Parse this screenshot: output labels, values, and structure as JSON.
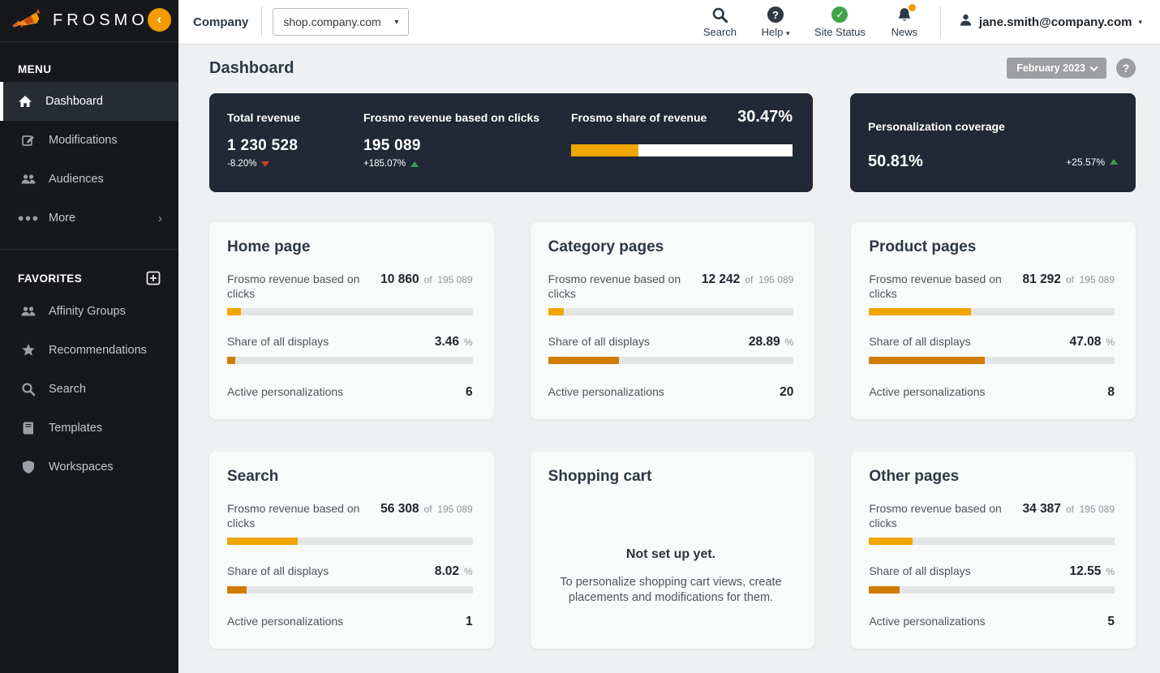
{
  "brand": {
    "name": "FROSMO"
  },
  "topbar": {
    "company_label": "Company",
    "site_selector_value": "shop.company.com",
    "nav": [
      {
        "label": "Search",
        "icon": "search-icon"
      },
      {
        "label": "Help",
        "icon": "question-circle-icon",
        "has_dropdown": true
      },
      {
        "label": "Site Status",
        "icon": "check-circle-icon"
      },
      {
        "label": "News",
        "icon": "bell-icon",
        "has_notification": true
      }
    ],
    "user_email": "jane.smith@company.com"
  },
  "sidebar": {
    "menu_header": "MENU",
    "menu_items": [
      {
        "label": "Dashboard",
        "icon": "home-icon",
        "active": true
      },
      {
        "label": "Modifications",
        "icon": "edit-icon"
      },
      {
        "label": "Audiences",
        "icon": "users-icon"
      },
      {
        "label": "More",
        "icon": "ellipsis-icon",
        "has_submenu": true
      }
    ],
    "favorites_header": "FAVORITES",
    "favorites_items": [
      {
        "label": "Affinity Groups",
        "icon": "users-icon"
      },
      {
        "label": "Recommendations",
        "icon": "star-icon"
      },
      {
        "label": "Search",
        "icon": "search-icon"
      },
      {
        "label": "Templates",
        "icon": "book-icon"
      },
      {
        "label": "Workspaces",
        "icon": "shield-icon"
      }
    ]
  },
  "page": {
    "title": "Dashboard",
    "period_button": "February 2023",
    "help_button": "?"
  },
  "overview": {
    "total_revenue": {
      "label": "Total revenue",
      "value": "1 230 528",
      "change": "-8.20%",
      "direction": "down"
    },
    "frosmo_revenue": {
      "label": "Frosmo revenue based on clicks",
      "value": "195 089",
      "change": "+185.07%",
      "direction": "up"
    },
    "share_of_revenue": {
      "label": "Frosmo share of revenue",
      "value": "30.47%",
      "percent": 30.47
    },
    "personalization_coverage": {
      "label": "Personalization coverage",
      "value": "50.81%",
      "change": "+25.57%",
      "direction": "up"
    }
  },
  "shared": {
    "revenue_label": "Frosmo revenue based on clicks",
    "of_label": "of",
    "revenue_total": "195 089",
    "share_label": "Share of all displays",
    "percent_sign": "%",
    "active_label": "Active personalizations"
  },
  "cards": [
    {
      "title": "Home page",
      "revenue": "10 860",
      "revenue_pct": 5.57,
      "share": "3.46",
      "share_pct": 3.46,
      "active": "6"
    },
    {
      "title": "Category pages",
      "revenue": "12 242",
      "revenue_pct": 6.27,
      "share": "28.89",
      "share_pct": 28.89,
      "active": "20"
    },
    {
      "title": "Product pages",
      "revenue": "81 292",
      "revenue_pct": 41.67,
      "share": "47.08",
      "share_pct": 47.08,
      "active": "8"
    },
    {
      "title": "Search",
      "revenue": "56 308",
      "revenue_pct": 28.86,
      "share": "8.02",
      "share_pct": 8.02,
      "active": "1"
    },
    {
      "title": "Shopping cart",
      "empty": true,
      "empty_title": "Not set up yet.",
      "empty_text": "To personalize shopping cart views, create placements and modifications for them."
    },
    {
      "title": "Other pages",
      "revenue": "34 387",
      "revenue_pct": 17.63,
      "share": "12.55",
      "share_pct": 12.55,
      "active": "5"
    }
  ],
  "colors": {
    "brand_orange": "#f59b00",
    "bar_fill_revenue": "#f0a500",
    "bar_fill_share": "#d07c00",
    "dark_card_bg": "#212836",
    "positive_green": "#3a9e4d",
    "negative_red": "#cf3f2f",
    "status_green": "#3fa34a"
  }
}
